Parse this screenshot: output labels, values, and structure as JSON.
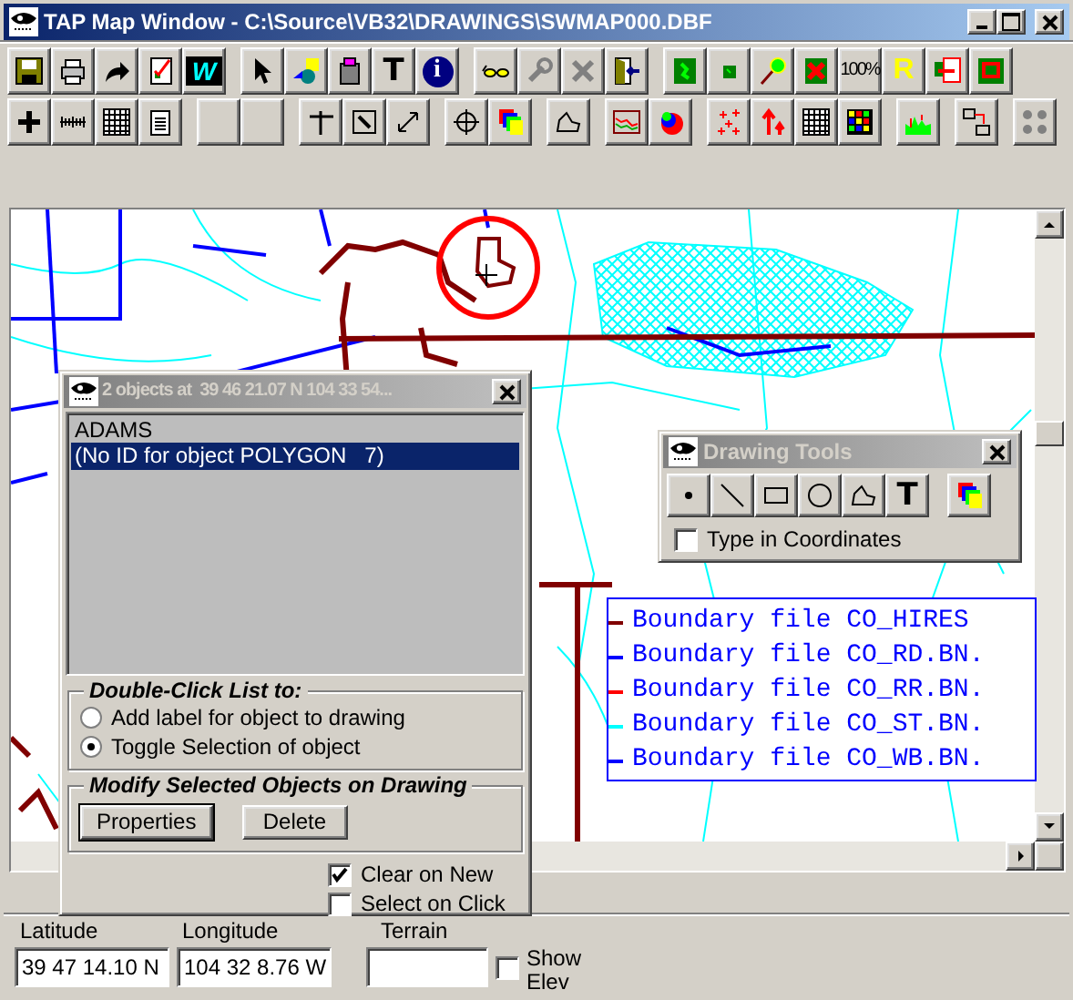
{
  "window": {
    "title": "TAP Map Window - C:\\Source\\VB32\\DRAWINGS\\SWMAP000.DBF"
  },
  "toolbar_rows": [
    [
      [
        {
          "kind": "save"
        },
        {
          "kind": "printer"
        },
        {
          "kind": "arrow"
        },
        {
          "kind": "checklist"
        },
        {
          "kind": "wtile",
          "label": "W"
        }
      ],
      [
        {
          "kind": "pointer"
        },
        {
          "kind": "shapes"
        },
        {
          "kind": "device"
        },
        {
          "kind": "tbold",
          "label": "T"
        },
        {
          "kind": "info",
          "label": "i"
        }
      ],
      [
        {
          "kind": "glasses"
        },
        {
          "kind": "wrench"
        },
        {
          "kind": "xgray"
        },
        {
          "kind": "door"
        }
      ],
      [
        {
          "kind": "greenmap"
        },
        {
          "kind": "greensmall"
        },
        {
          "kind": "pin"
        },
        {
          "kind": "greenx"
        },
        {
          "kind": "percent",
          "label": "100%"
        },
        {
          "kind": "rletter",
          "label": "R"
        },
        {
          "kind": "copymap"
        },
        {
          "kind": "greenred"
        }
      ]
    ],
    [
      [
        {
          "kind": "plus"
        },
        {
          "kind": "ruler"
        },
        {
          "kind": "grid"
        },
        {
          "kind": "notepad"
        }
      ],
      [
        {
          "kind": "blank"
        },
        {
          "kind": "blank"
        }
      ],
      [
        {
          "kind": "crossline"
        },
        {
          "kind": "needlebox"
        },
        {
          "kind": "diag"
        }
      ],
      [
        {
          "kind": "move"
        },
        {
          "kind": "colors"
        }
      ],
      [
        {
          "kind": "polygon"
        }
      ],
      [
        {
          "kind": "linechart"
        },
        {
          "kind": "sphere"
        }
      ],
      [
        {
          "kind": "plusmarks"
        },
        {
          "kind": "arrowsup"
        },
        {
          "kind": "grid"
        },
        {
          "kind": "colorgrid"
        }
      ],
      [
        {
          "kind": "histogram"
        }
      ],
      [
        {
          "kind": "tablearrow"
        }
      ],
      [
        {
          "kind": "dotsgray"
        }
      ]
    ]
  ],
  "legend": [
    {
      "label": "Boundary file CO_HIRES",
      "color": "#800000"
    },
    {
      "label": "Boundary file CO_RD.BN.",
      "color": "#0000ff"
    },
    {
      "label": "Boundary file CO_RR.BN.",
      "color": "#ff0000"
    },
    {
      "label": "Boundary file CO_ST.BN.",
      "color": "#00ffff"
    },
    {
      "label": "Boundary file CO_WB.BN.",
      "color": "#0000ff"
    }
  ],
  "objects_window": {
    "title": "2 objects at  39 46 21.07 N 104 33 54...",
    "items": [
      {
        "label": "ADAMS",
        "selected": false
      },
      {
        "label": "(No ID for object POLYGON   7)",
        "selected": true
      }
    ],
    "double_click_group": {
      "title": "Double-Click List to:",
      "options": [
        {
          "label": "Add label for object to drawing",
          "selected": false
        },
        {
          "label": "Toggle Selection of  object",
          "selected": true
        }
      ]
    },
    "modify_group": {
      "title": "Modify Selected Objects on Drawing",
      "buttons": [
        "Properties",
        "Delete"
      ]
    },
    "checkboxes": [
      {
        "label": "Clear on New",
        "checked": true
      },
      {
        "label": "Select on Click",
        "checked": false
      }
    ]
  },
  "drawing_tools": {
    "title": "Drawing Tools",
    "tools": [
      {
        "kind": "dot"
      },
      {
        "kind": "line"
      },
      {
        "kind": "rect"
      },
      {
        "kind": "circle"
      },
      {
        "kind": "polygon"
      },
      {
        "kind": "tbold",
        "label": "T"
      },
      {
        "kind": "colors"
      }
    ],
    "checkbox": {
      "label": "Type in Coordinates",
      "checked": false
    }
  },
  "status": {
    "latitude": {
      "label": "Latitude",
      "value": "39 47 14.10 N"
    },
    "longitude": {
      "label": "Longitude",
      "value": "104 32 8.76 W"
    },
    "terrain": {
      "label": "Terrain"
    },
    "show_elev": {
      "label": "Show Elev",
      "checked": false
    }
  }
}
